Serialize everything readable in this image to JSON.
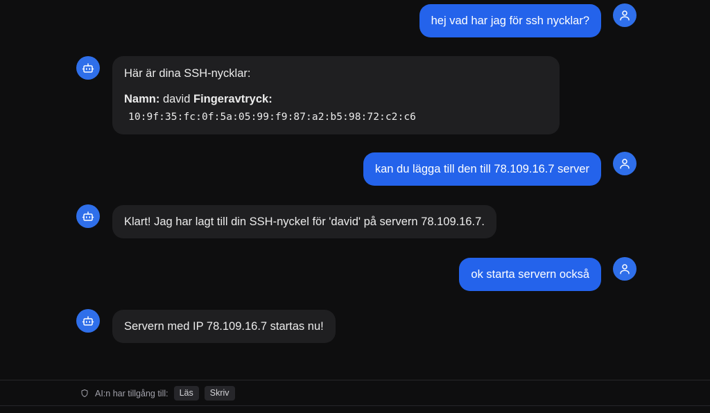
{
  "colors": {
    "background": "#0e0e0f",
    "user_bubble": "#2463eb",
    "bot_bubble": "#1f1f21",
    "avatar": "#2f6fea",
    "footer_text": "#a1a1aa"
  },
  "messages": [
    {
      "role": "user",
      "text": "hej vad har jag för ssh nycklar?",
      "avatar_icon": "user-icon"
    },
    {
      "role": "assistant",
      "avatar_icon": "bot-icon",
      "intro": "Här är dina SSH-nycklar:",
      "name_label": "Namn:",
      "name_value": "david",
      "fingerprint_label": "Fingeravtryck:",
      "fingerprint_value": "10:9f:35:fc:0f:5a:05:99:f9:87:a2:b5:98:72:c2:c6"
    },
    {
      "role": "user",
      "text": "kan du lägga till den till 78.109.16.7 server",
      "avatar_icon": "user-icon"
    },
    {
      "role": "assistant",
      "avatar_icon": "bot-icon",
      "text": "Klart! Jag har lagt till din SSH-nyckel för 'david' på servern 78.109.16.7."
    },
    {
      "role": "user",
      "text": "ok starta servern också",
      "avatar_icon": "user-icon"
    },
    {
      "role": "assistant",
      "avatar_icon": "bot-icon",
      "text": "Servern med IP 78.109.16.7 startas nu!"
    }
  ],
  "footer": {
    "icon": "shield-icon",
    "label": "AI:n har tillgång till:",
    "permissions": [
      "Läs",
      "Skriv"
    ]
  }
}
